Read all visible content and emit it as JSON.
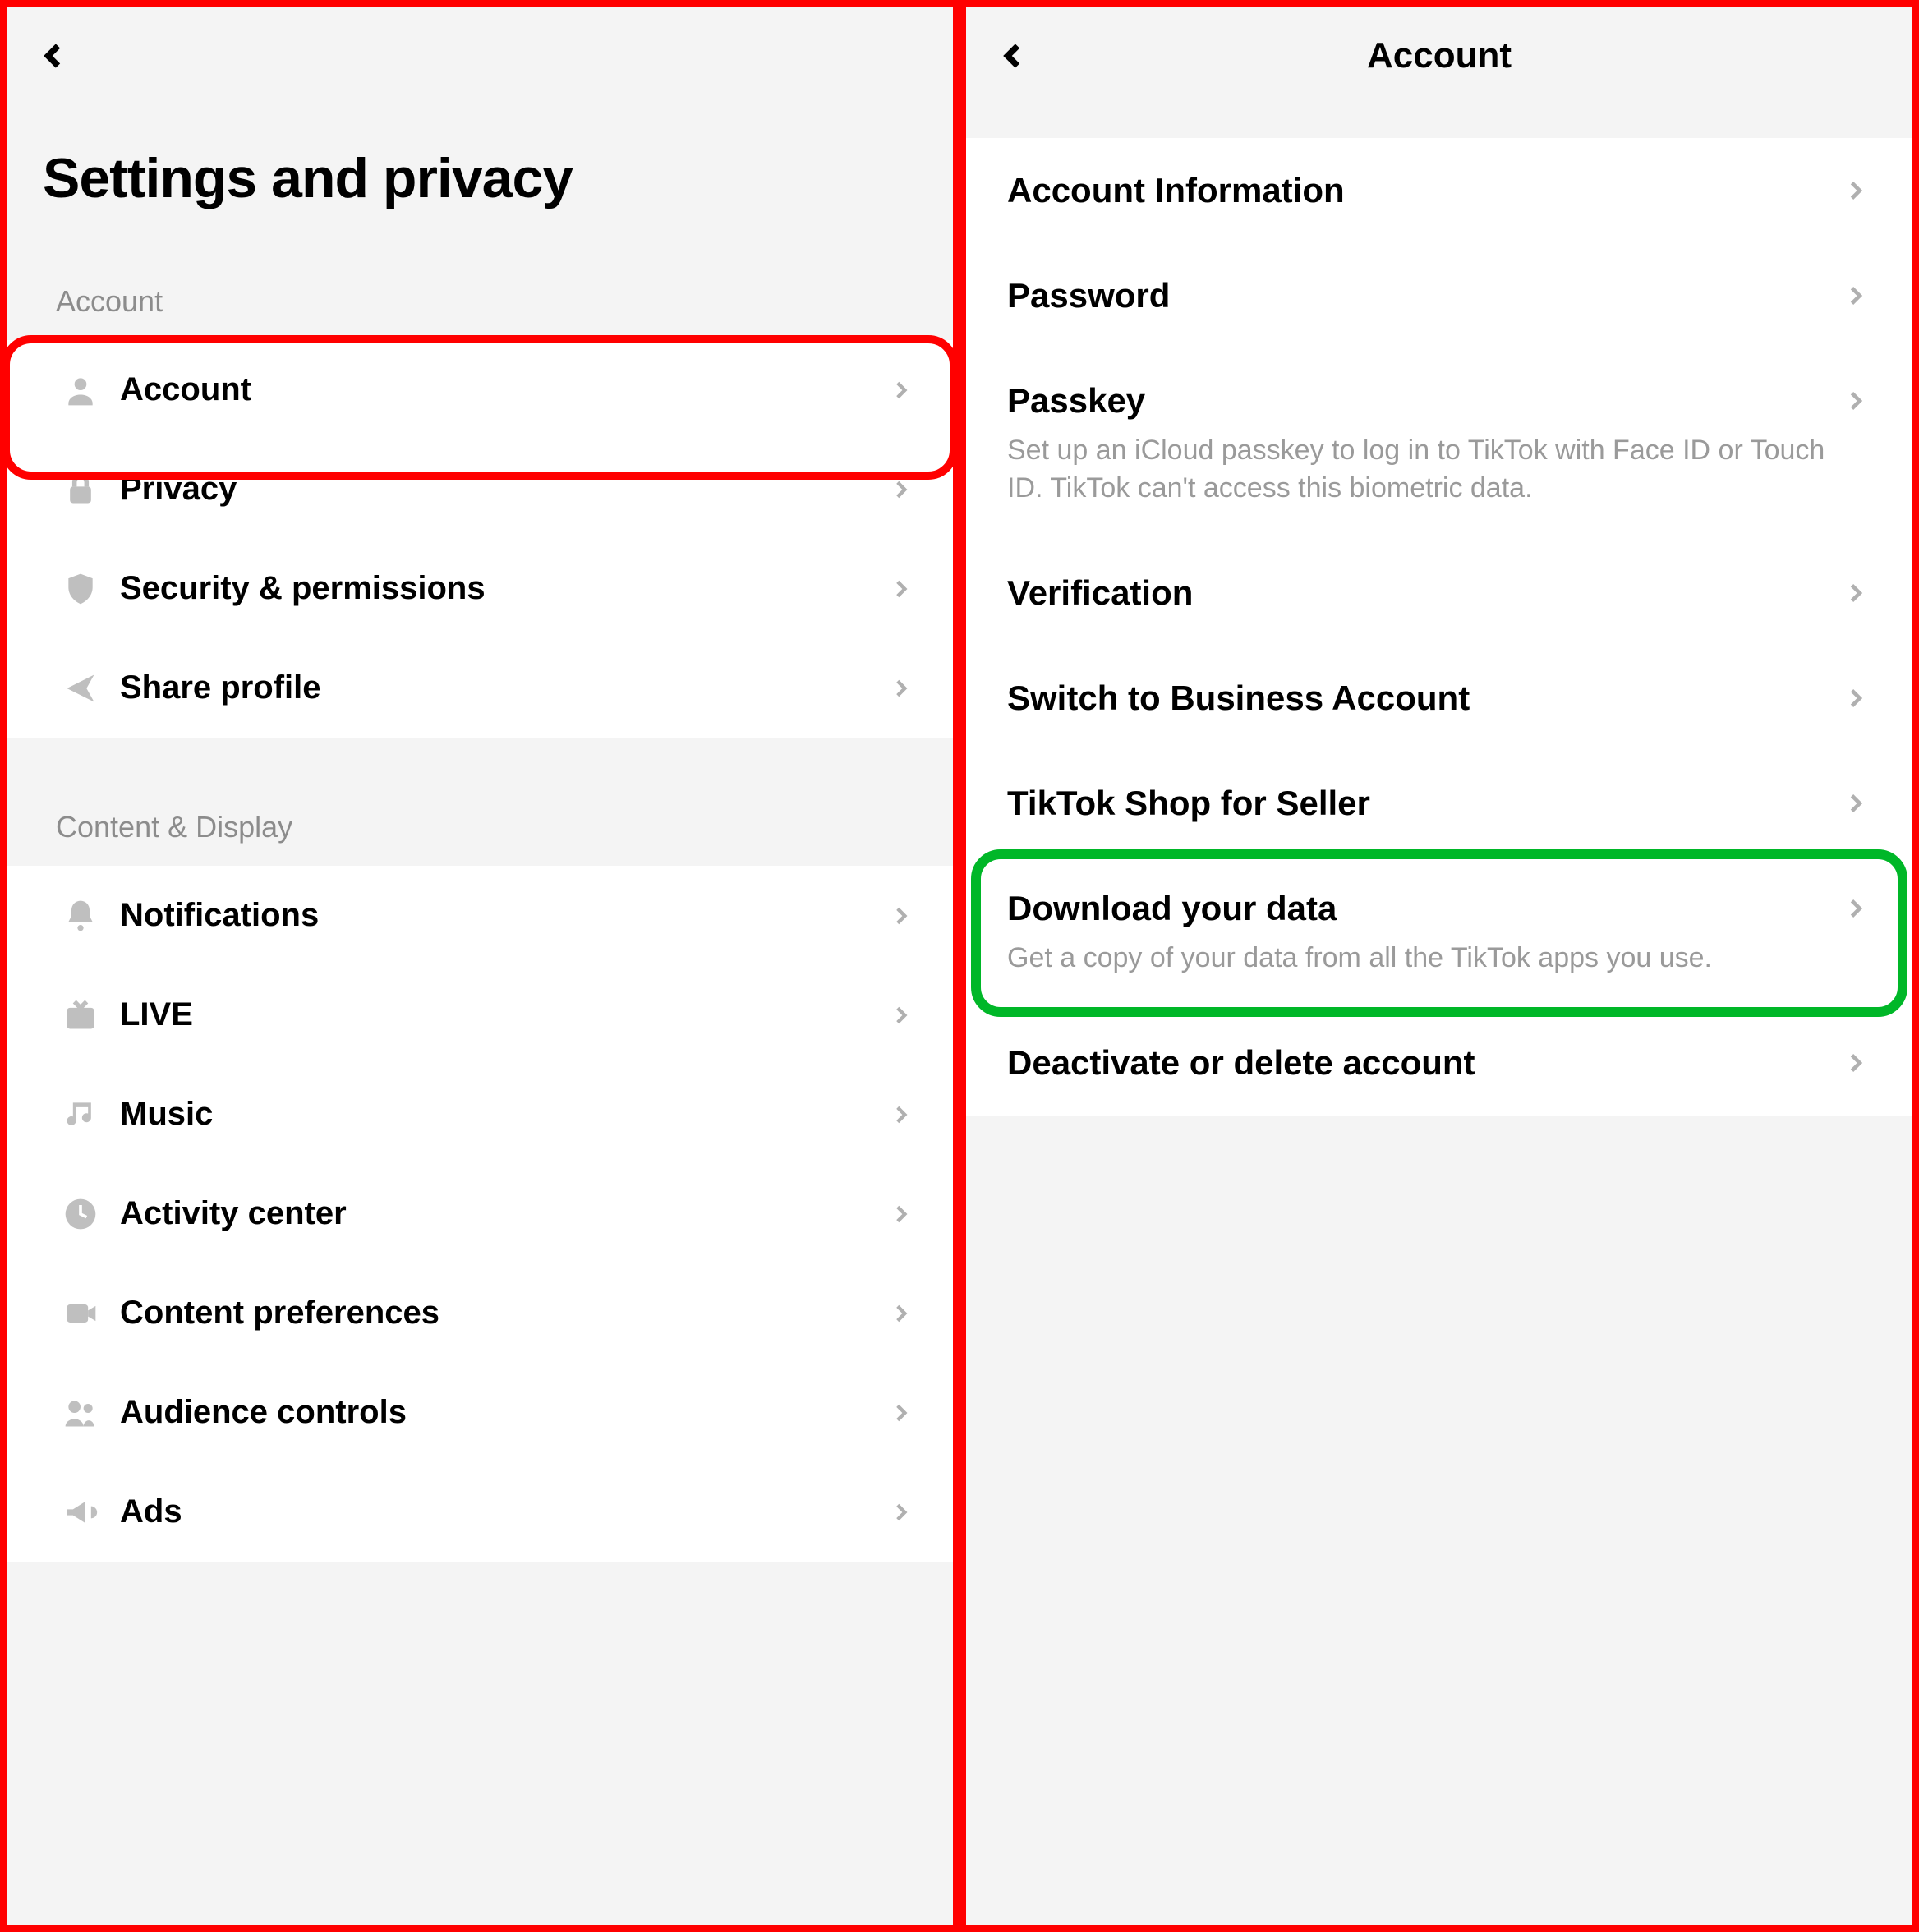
{
  "left": {
    "page_title": "Settings and privacy",
    "sections": [
      {
        "label": "Account",
        "items": [
          {
            "icon": "person",
            "label": "Account"
          },
          {
            "icon": "lock",
            "label": "Privacy"
          },
          {
            "icon": "shield",
            "label": "Security & permissions"
          },
          {
            "icon": "share",
            "label": "Share profile"
          }
        ]
      },
      {
        "label": "Content & Display",
        "items": [
          {
            "icon": "bell",
            "label": "Notifications"
          },
          {
            "icon": "tv",
            "label": "LIVE"
          },
          {
            "icon": "music",
            "label": "Music"
          },
          {
            "icon": "clock",
            "label": "Activity center"
          },
          {
            "icon": "camera",
            "label": "Content preferences"
          },
          {
            "icon": "people",
            "label": "Audience controls"
          },
          {
            "icon": "megaphone",
            "label": "Ads"
          }
        ]
      }
    ]
  },
  "right": {
    "header_title": "Account",
    "items": [
      {
        "label": "Account Information"
      },
      {
        "label": "Password"
      },
      {
        "label": "Passkey",
        "sub": "Set up an iCloud passkey to log in to TikTok with Face ID or Touch ID. TikTok can't access this biometric data."
      },
      {
        "label": "Verification"
      },
      {
        "label": "Switch to Business Account"
      },
      {
        "label": "TikTok Shop for Seller"
      },
      {
        "label": "Download your data",
        "sub": "Get a copy of your data from all the TikTok apps you use."
      },
      {
        "label": "Deactivate or delete account"
      }
    ]
  },
  "highlights": {
    "left_red_item_index": 0,
    "right_green_item_index": 6
  }
}
